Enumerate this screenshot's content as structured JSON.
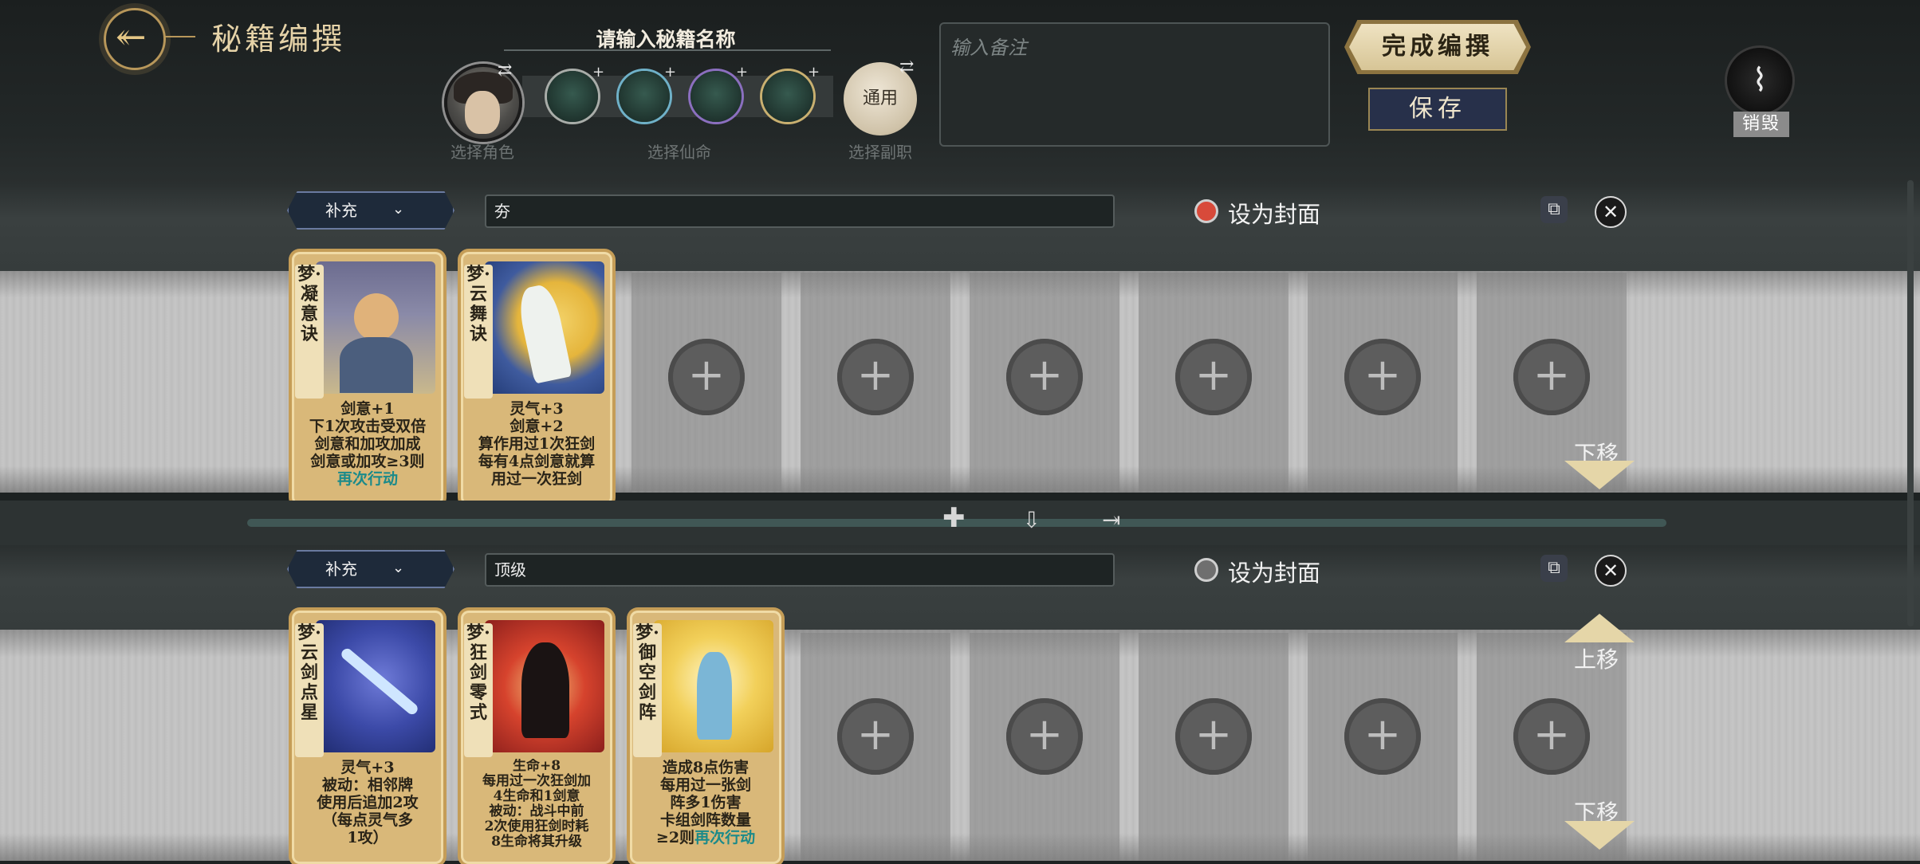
{
  "header": {
    "title": "秘籍编撰",
    "name_prompt": "请输入秘籍名称",
    "select_role": "选择角色",
    "select_fate": "选择仙命",
    "select_job": "选择副职",
    "job_value": "通用",
    "notes_placeholder": "输入备注",
    "finish_label": "完成编撰",
    "save_label": "保存",
    "destroy_label": "销毁"
  },
  "rows": [
    {
      "type": "补充",
      "name": "夯",
      "cover_label": "设为封面",
      "cover_selected": true,
      "move_down": "下移",
      "cards": [
        {
          "title": "梦·凝意诀",
          "lines": [
            "剑意+1",
            "下1次攻击受双倍",
            "剑意和加攻加成",
            "剑意或加攻≥3则",
            "再次行动"
          ]
        },
        {
          "title": "梦·云舞诀",
          "lines": [
            "灵气+3",
            "剑意+2",
            "算作用过1次狂剑",
            "每有4点剑意就算",
            "用过一次狂剑"
          ]
        }
      ]
    },
    {
      "type": "补充",
      "name": "顶级",
      "cover_label": "设为封面",
      "cover_selected": false,
      "move_up": "上移",
      "move_down": "下移",
      "cards": [
        {
          "title": "梦·云剑点星",
          "lines": [
            "灵气+3",
            "被动：相邻牌",
            "使用后追加2攻",
            "（每点灵气多",
            "1攻）"
          ]
        },
        {
          "title": "梦·狂剑零式",
          "lines": [
            "生命+8",
            "每用过一次狂剑加",
            "4生命和1剑意",
            "被动：战斗中前",
            "2次使用狂剑时耗",
            "8生命将其升级"
          ]
        },
        {
          "title": "梦·御空剑阵",
          "lines": [
            "造成8点伤害",
            "每用过一张剑",
            "阵多1伤害",
            "卡组剑阵数量",
            "≥2则",
            "再次行动"
          ]
        }
      ]
    }
  ],
  "colors": {
    "gold": "#d9b879",
    "accent_red": "#cc1f1f",
    "accent_blue": "#1f5fbf",
    "accent_teal": "#1b8a8a"
  }
}
